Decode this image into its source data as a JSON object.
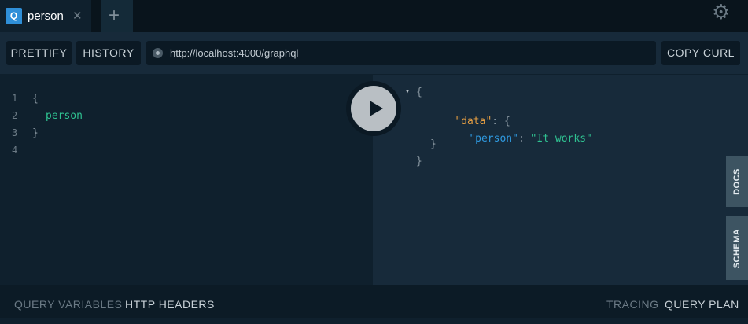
{
  "tab": {
    "badge": "Q",
    "title": "person",
    "close": "✕"
  },
  "new_tab": "+",
  "settings_icon": "⚙",
  "toolbar": {
    "prettify": "PRETTIFY",
    "history": "HISTORY",
    "url": "http://localhost:4000/graphql",
    "copy_curl": "COPY CURL"
  },
  "editor": {
    "line_numbers": [
      "1",
      "2",
      "3",
      "4"
    ],
    "lines": [
      "{",
      "person",
      "}",
      ""
    ]
  },
  "result": {
    "collapse_arrow": "▾",
    "open_brace": "{",
    "data_key": "\"data\"",
    "person_key": "\"person\"",
    "person_value": "\"It works\"",
    "colon": ":",
    "inner_open": "{",
    "inner_close": "}",
    "close_brace": "}"
  },
  "side_tabs": {
    "docs": "DOCS",
    "schema": "SCHEMA"
  },
  "footer": {
    "query_variables": "QUERY VARIABLES",
    "http_headers": "HTTP HEADERS",
    "tracing": "TRACING",
    "query_plan": "QUERY PLAN"
  },
  "colors": {
    "accent": "#2f8fd8",
    "string_green": "#2fc291",
    "key_orange": "#e39d43",
    "key_blue": "#2f9ae0"
  }
}
